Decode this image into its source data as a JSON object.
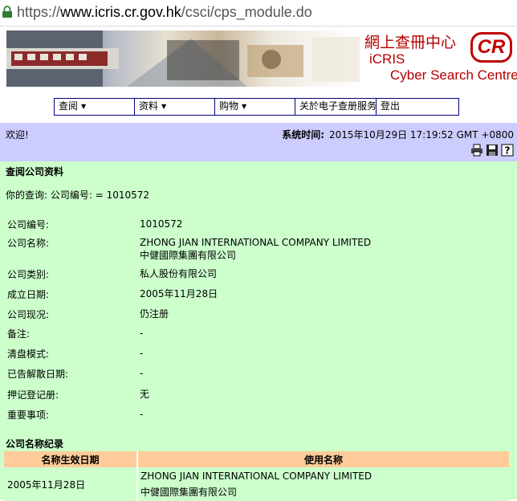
{
  "browser": {
    "url_scheme": "https://",
    "url_host": "www.icris.cr.gov.hk",
    "url_path": "/csci/cps_module.do",
    "lock_icon": "lock-icon"
  },
  "banner": {
    "logo_chinese": "網上查冊中心",
    "logo_cr": "CR",
    "logo_name": "iCRIS",
    "logo_tagline": "Cyber Search Centre"
  },
  "menu": {
    "items": [
      {
        "label": "查阅",
        "has_dropdown": true
      },
      {
        "label": "资料",
        "has_dropdown": true
      },
      {
        "label": "购物",
        "has_dropdown": true
      },
      {
        "label": "关於电子查册服务",
        "has_dropdown": false
      },
      {
        "label": "登出",
        "has_dropdown": false
      }
    ]
  },
  "welcome": {
    "greeting": "欢迎!",
    "time_label": "系统时间:",
    "time_value": "2015年10月29日 17:19:52 GMT +0800",
    "icons": [
      "printer-icon",
      "save-icon",
      "help-icon"
    ]
  },
  "company": {
    "section_title": "查阅公司资料",
    "query": "你的查询: 公司编号: = 1010572",
    "fields": [
      {
        "label": "公司编号:",
        "values": [
          "1010572"
        ]
      },
      {
        "label": "公司名称:",
        "values": [
          "ZHONG JIAN INTERNATIONAL COMPANY LIMITED",
          "中健國際集團有限公司"
        ]
      },
      {
        "label": "公司类别:",
        "values": [
          "私人股份有限公司"
        ]
      },
      {
        "label": "成立日期:",
        "values": [
          "2005年11月28日"
        ]
      },
      {
        "label": "公司现况:",
        "values": [
          "仍注册"
        ]
      },
      {
        "label": "备注:",
        "values": [
          "-"
        ]
      },
      {
        "label": "清盘模式:",
        "values": [
          "-"
        ]
      },
      {
        "label": "已告解散日期:",
        "values": [
          "-"
        ]
      },
      {
        "label": "押记登记册:",
        "values": [
          "无"
        ]
      },
      {
        "label": "重要事项:",
        "values": [
          "-"
        ]
      }
    ]
  },
  "name_history": {
    "section_title": "公司名称纪录",
    "columns": [
      "名称生效日期",
      "使用名称"
    ],
    "rows": [
      {
        "date": "2005年11月28日",
        "names": [
          "ZHONG JIAN INTERNATIONAL COMPANY LIMITED",
          "中健國際集團有限公司"
        ]
      }
    ]
  },
  "colors": {
    "welcome_bar": "#ccccff",
    "content_bg": "#ccffcc",
    "table_header": "#ffcc99",
    "brand_red": "#b40000"
  }
}
